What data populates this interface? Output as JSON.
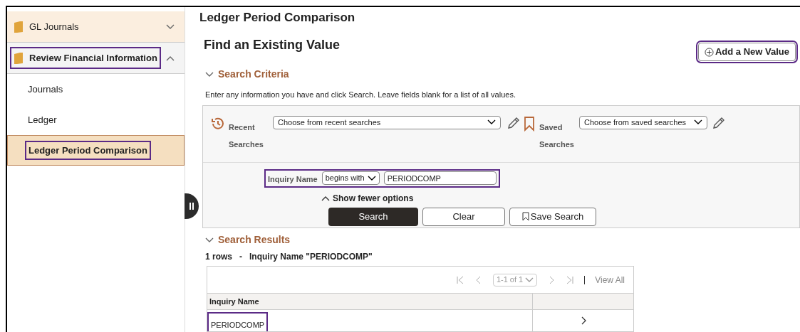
{
  "sidebar": {
    "items": [
      {
        "label": "GL Journals",
        "kind": "folder",
        "expanded": false,
        "selected": false,
        "highlighted": false
      },
      {
        "label": "Review Financial Information",
        "kind": "folder",
        "expanded": true,
        "selected": false,
        "highlighted": true
      },
      {
        "label": "Journals",
        "kind": "link",
        "selected": false,
        "highlighted": false
      },
      {
        "label": "Ledger",
        "kind": "link",
        "selected": false,
        "highlighted": false
      },
      {
        "label": "Ledger Period Comparison",
        "kind": "link",
        "selected": true,
        "highlighted": true
      }
    ]
  },
  "page_title": "Ledger Period Comparison",
  "heading": "Find an Existing Value",
  "add_button": {
    "label": "Add a New Value",
    "highlighted": true
  },
  "search_criteria": {
    "title": "Search Criteria",
    "expanded": true,
    "instructions": "Enter any information you have and click Search. Leave fields blank for a list of all values.",
    "recent": {
      "label_1": "Recent",
      "label_2": "Searches",
      "value": "Choose from recent searches"
    },
    "saved": {
      "label_1": "Saved",
      "label_2": "Searches",
      "value": "Choose from saved searches"
    },
    "filter": {
      "label": "Inquiry Name",
      "operator": "begins with",
      "value": "PERIODCOMP",
      "highlighted": true
    },
    "toggle": "Show fewer options",
    "buttons": [
      {
        "label": "Search",
        "kind": "primary"
      },
      {
        "label": "Clear",
        "kind": "plain"
      },
      {
        "label": "Save Search",
        "kind": "bookmark"
      }
    ]
  },
  "search_results": {
    "title": "Search Results",
    "expanded": true,
    "summary": "1 rows   -   Inquiry Name \"PERIODCOMP\"",
    "pager": {
      "range": "1-1 of 1",
      "view_all": "View All"
    },
    "columns": [
      "Inquiry Name"
    ],
    "rows": [
      {
        "inquiry_name": "PERIODCOMP",
        "highlighted": true
      }
    ]
  }
}
